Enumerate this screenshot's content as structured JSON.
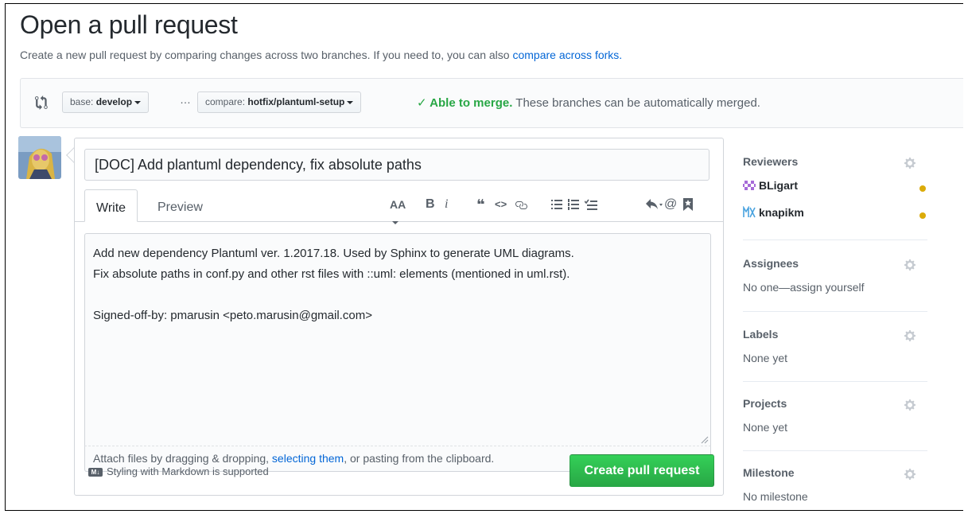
{
  "header": {
    "title": "Open a pull request",
    "subtitle": "Create a new pull request by comparing changes across two branches. If you need to, you can also",
    "subtitle_link": "compare across forks."
  },
  "range": {
    "base_label": "base:",
    "base_branch": "develop",
    "ellipsis": "…",
    "compare_label": "compare:",
    "compare_branch": "hotfix/plantuml-setup",
    "merge_ok": "✓ Able to merge.",
    "merge_text": "These branches can be automatically merged."
  },
  "composer": {
    "title_value": "[DOC] Add plantuml dependency, fix absolute paths",
    "tab_write": "Write",
    "tab_preview": "Preview",
    "body": "Add new dependency Plantuml ver. 1.2017.18. Used by Sphinx to generate UML diagrams.\nFix absolute paths in conf.py and other rst files with ::uml: elements (mentioned in uml.rst).\n\nSigned-off-by: pmarusin <peto.marusin@gmail.com>",
    "attach_prefix": "Attach files by dragging & dropping,",
    "attach_link": "selecting them",
    "attach_suffix": ", or pasting from the clipboard.",
    "markdown_note": "Styling with Markdown is supported",
    "markdown_badge": "M↓",
    "create_button": "Create pull request",
    "toolbar": {
      "heading": "AA",
      "bold": "B",
      "italic": "i",
      "quote": "❝",
      "code": "<>"
    }
  },
  "sidebar": {
    "reviewers": {
      "title": "Reviewers",
      "items": [
        {
          "name": "BLigart",
          "status_color": "#dbab09"
        },
        {
          "name": "knapikm",
          "status_color": "#dbab09"
        }
      ]
    },
    "assignees": {
      "title": "Assignees",
      "value": "No one—assign yourself"
    },
    "labels": {
      "title": "Labels",
      "value": "None yet"
    },
    "projects": {
      "title": "Projects",
      "value": "None yet"
    },
    "milestone": {
      "title": "Milestone",
      "value": "No milestone"
    }
  },
  "colors": {
    "accent_link": "#0366d6",
    "success": "#28a745",
    "button_green": "#2ea44f"
  }
}
